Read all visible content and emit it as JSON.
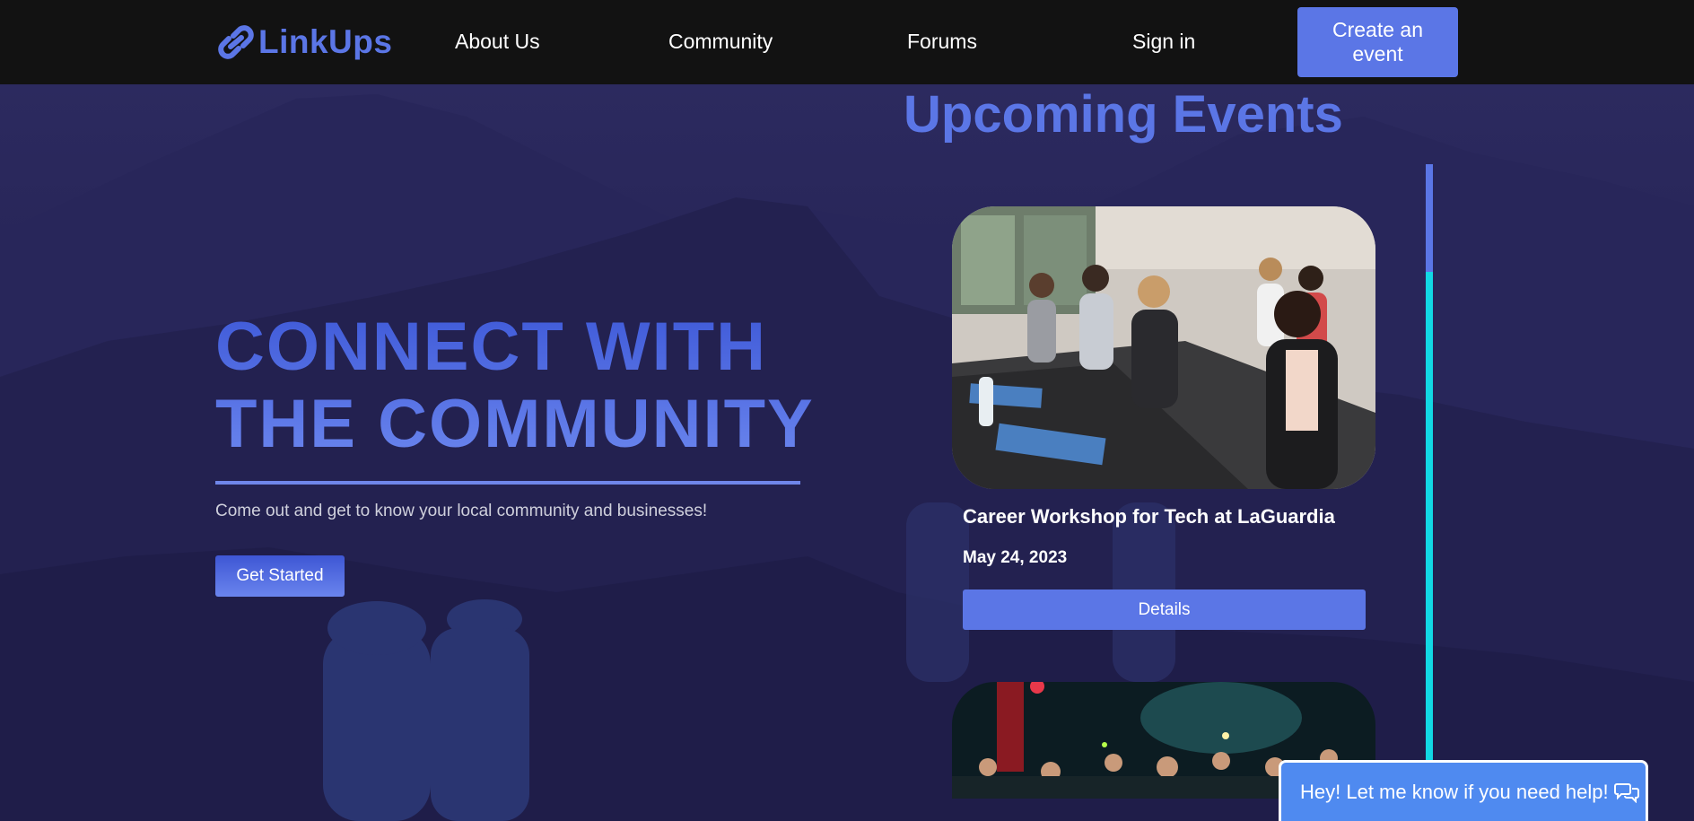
{
  "nav": {
    "logo_text": "LinkUps",
    "links": [
      "About Us",
      "Community",
      "Forums",
      "Sign in"
    ],
    "create_button": "Create an event"
  },
  "hero": {
    "title_line1": "CONNECT WITH",
    "title_line2": "THE COMMUNITY",
    "subtitle": "Come out and get to know your local community and businesses!",
    "cta": "Get Started"
  },
  "events": {
    "heading": "Upcoming Events",
    "items": [
      {
        "name": "Career Workshop for Tech at LaGuardia",
        "date": "May 24, 2023",
        "button": "Details",
        "image": "workshop-photo"
      },
      {
        "image": "concert-crowd-photo"
      }
    ]
  },
  "chat": {
    "text": "Hey! Let me know if you need help!",
    "icon": "chat-bubbles-icon"
  },
  "colors": {
    "accent": "#5b76e6",
    "nav_bg": "#121212",
    "scroll_track": "#12d8e4",
    "chat_bg": "#4f8af0",
    "hero_bg": "#1c1a4a"
  }
}
